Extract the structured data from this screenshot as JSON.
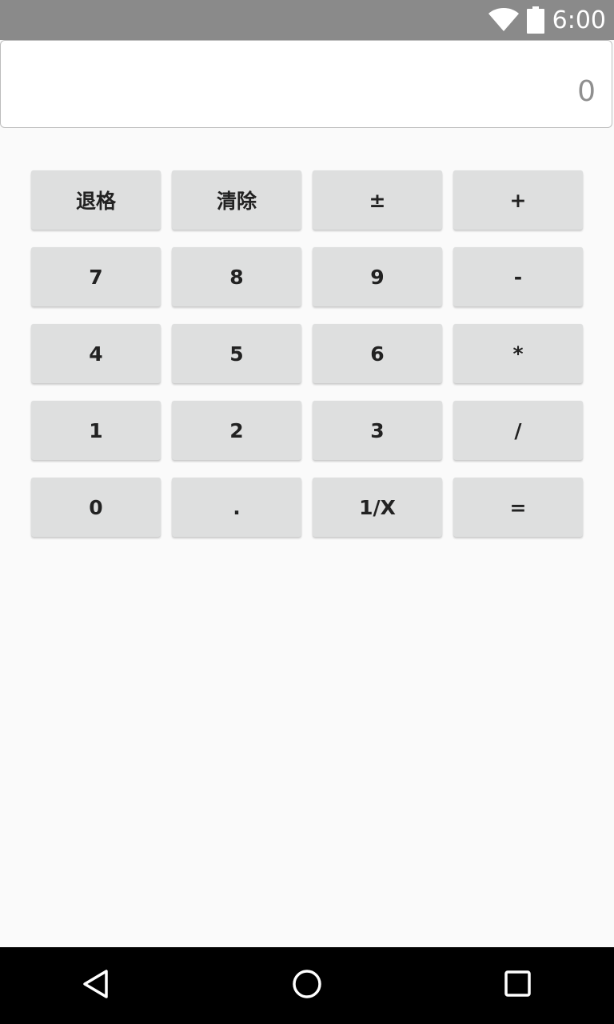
{
  "status_bar": {
    "time": "6:00",
    "icons": [
      "wifi-icon",
      "battery-icon"
    ]
  },
  "display": {
    "value": "0"
  },
  "keypad": {
    "rows": [
      [
        "退格",
        "清除",
        "±",
        "+"
      ],
      [
        "7",
        "8",
        "9",
        "-"
      ],
      [
        "4",
        "5",
        "6",
        "*"
      ],
      [
        "1",
        "2",
        "3",
        "/"
      ],
      [
        "0",
        ".",
        "1/X",
        "="
      ]
    ]
  },
  "nav_bar": {
    "icons": [
      "back-icon",
      "home-icon",
      "recents-icon"
    ]
  },
  "colors": {
    "status_bar": "#8a8a8a",
    "background": "#fafafa",
    "key": "#dedfdf",
    "key_text": "#222222",
    "display_text": "#8f8f8f",
    "nav_bar": "#000000"
  }
}
